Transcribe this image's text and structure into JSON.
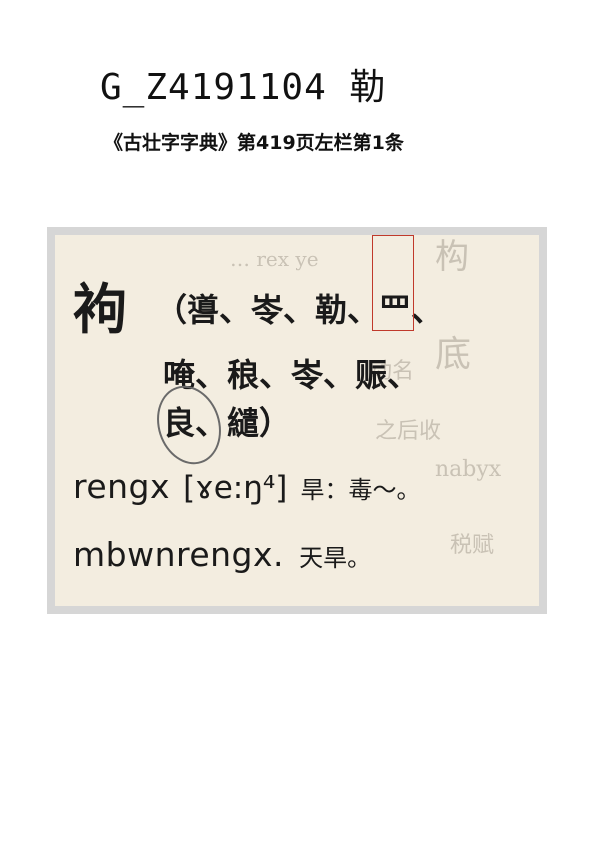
{
  "header": {
    "code": "G_Z4191104 勒",
    "source": "《古壮字字典》第419页左栏第1条"
  },
  "entry": {
    "headword": "袧",
    "variant_lines": [
      "（噵、岺、勒、罒、",
      "唵、稂、岺、赈、",
      "良、繾）"
    ],
    "romanization": "rengx",
    "ipa": "[ɤe:ŋ⁴]",
    "gloss": "旱：毒～。",
    "example_roman": "mbwnrengx.",
    "example_gloss": "天旱。"
  },
  "colors": {
    "highlight_box": "#c0392b",
    "paper": "#f3ede0"
  }
}
